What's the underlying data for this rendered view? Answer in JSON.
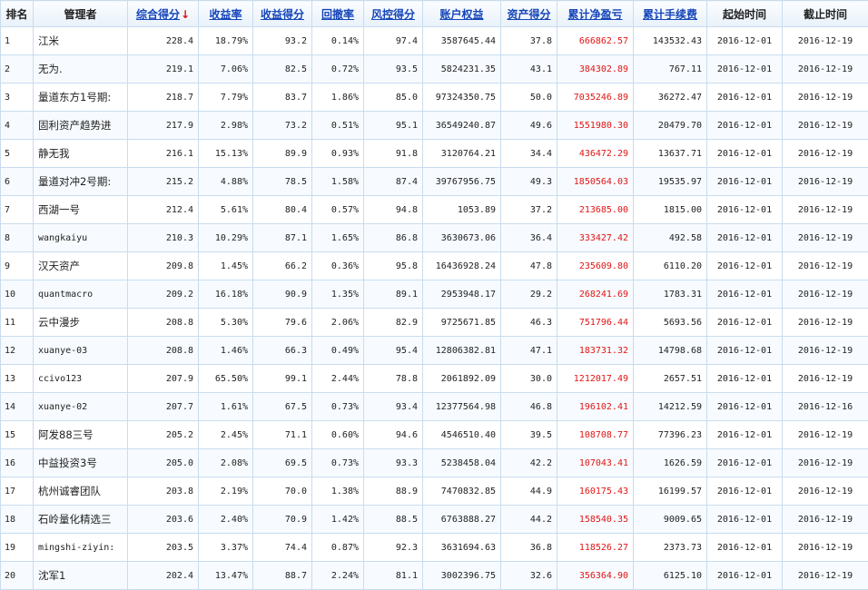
{
  "header": {
    "rank": "排名",
    "manager": "管理者",
    "total_score": "综合得分",
    "sort_arrow": "↓",
    "return_rate": "收益率",
    "return_score": "收益得分",
    "drawdown": "回撤率",
    "risk_score": "风控得分",
    "equity": "账户权益",
    "asset_score": "资产得分",
    "net_pnl": "累计净盈亏",
    "fees": "累计手续费",
    "start_date": "起始时间",
    "end_date": "截止时间"
  },
  "colors": {
    "link": "#1545b8",
    "sort_arrow": "#e01010",
    "pnl": "#e01515",
    "grid": "#c9dced"
  },
  "rows": [
    {
      "rank": "1",
      "manager": "江米",
      "total": "228.4",
      "ret": "18.79%",
      "rets": "93.2",
      "dd": "0.14%",
      "risk": "97.4",
      "equity": "3587645.44",
      "asset": "37.8",
      "pnl": "666862.57",
      "fee": "143532.43",
      "start": "2016-12-01",
      "end": "2016-12-19"
    },
    {
      "rank": "2",
      "manager": "无为.",
      "total": "219.1",
      "ret": "7.06%",
      "rets": "82.5",
      "dd": "0.72%",
      "risk": "93.5",
      "equity": "5824231.35",
      "asset": "43.1",
      "pnl": "384302.89",
      "fee": "767.11",
      "start": "2016-12-01",
      "end": "2016-12-19"
    },
    {
      "rank": "3",
      "manager": "量道东方1号期:",
      "total": "218.7",
      "ret": "7.79%",
      "rets": "83.7",
      "dd": "1.86%",
      "risk": "85.0",
      "equity": "97324350.75",
      "asset": "50.0",
      "pnl": "7035246.89",
      "fee": "36272.47",
      "start": "2016-12-01",
      "end": "2016-12-19"
    },
    {
      "rank": "4",
      "manager": "固利资产趋势进",
      "total": "217.9",
      "ret": "2.98%",
      "rets": "73.2",
      "dd": "0.51%",
      "risk": "95.1",
      "equity": "36549240.87",
      "asset": "49.6",
      "pnl": "1551980.30",
      "fee": "20479.70",
      "start": "2016-12-01",
      "end": "2016-12-19"
    },
    {
      "rank": "5",
      "manager": "静无我",
      "total": "216.1",
      "ret": "15.13%",
      "rets": "89.9",
      "dd": "0.93%",
      "risk": "91.8",
      "equity": "3120764.21",
      "asset": "34.4",
      "pnl": "436472.29",
      "fee": "13637.71",
      "start": "2016-12-01",
      "end": "2016-12-19"
    },
    {
      "rank": "6",
      "manager": "量道对冲2号期:",
      "total": "215.2",
      "ret": "4.88%",
      "rets": "78.5",
      "dd": "1.58%",
      "risk": "87.4",
      "equity": "39767956.75",
      "asset": "49.3",
      "pnl": "1850564.03",
      "fee": "19535.97",
      "start": "2016-12-01",
      "end": "2016-12-19"
    },
    {
      "rank": "7",
      "manager": "西湖一号",
      "total": "212.4",
      "ret": "5.61%",
      "rets": "80.4",
      "dd": "0.57%",
      "risk": "94.8",
      "equity": "1053.89",
      "asset": "37.2",
      "pnl": "213685.00",
      "fee": "1815.00",
      "start": "2016-12-01",
      "end": "2016-12-19"
    },
    {
      "rank": "8",
      "manager": "wangkaiyu",
      "total": "210.3",
      "ret": "10.29%",
      "rets": "87.1",
      "dd": "1.65%",
      "risk": "86.8",
      "equity": "3630673.06",
      "asset": "36.4",
      "pnl": "333427.42",
      "fee": "492.58",
      "start": "2016-12-01",
      "end": "2016-12-19"
    },
    {
      "rank": "9",
      "manager": "汉天资产",
      "total": "209.8",
      "ret": "1.45%",
      "rets": "66.2",
      "dd": "0.36%",
      "risk": "95.8",
      "equity": "16436928.24",
      "asset": "47.8",
      "pnl": "235609.80",
      "fee": "6110.20",
      "start": "2016-12-01",
      "end": "2016-12-19"
    },
    {
      "rank": "10",
      "manager": "quantmacro",
      "total": "209.2",
      "ret": "16.18%",
      "rets": "90.9",
      "dd": "1.35%",
      "risk": "89.1",
      "equity": "2953948.17",
      "asset": "29.2",
      "pnl": "268241.69",
      "fee": "1783.31",
      "start": "2016-12-01",
      "end": "2016-12-19"
    },
    {
      "rank": "11",
      "manager": "云中漫步",
      "total": "208.8",
      "ret": "5.30%",
      "rets": "79.6",
      "dd": "2.06%",
      "risk": "82.9",
      "equity": "9725671.85",
      "asset": "46.3",
      "pnl": "751796.44",
      "fee": "5693.56",
      "start": "2016-12-01",
      "end": "2016-12-19"
    },
    {
      "rank": "12",
      "manager": "xuanye-03",
      "total": "208.8",
      "ret": "1.46%",
      "rets": "66.3",
      "dd": "0.49%",
      "risk": "95.4",
      "equity": "12806382.81",
      "asset": "47.1",
      "pnl": "183731.32",
      "fee": "14798.68",
      "start": "2016-12-01",
      "end": "2016-12-19"
    },
    {
      "rank": "13",
      "manager": "ccivo123",
      "total": "207.9",
      "ret": "65.50%",
      "rets": "99.1",
      "dd": "2.44%",
      "risk": "78.8",
      "equity": "2061892.09",
      "asset": "30.0",
      "pnl": "1212017.49",
      "fee": "2657.51",
      "start": "2016-12-01",
      "end": "2016-12-19"
    },
    {
      "rank": "14",
      "manager": "xuanye-02",
      "total": "207.7",
      "ret": "1.61%",
      "rets": "67.5",
      "dd": "0.73%",
      "risk": "93.4",
      "equity": "12377564.98",
      "asset": "46.8",
      "pnl": "196102.41",
      "fee": "14212.59",
      "start": "2016-12-01",
      "end": "2016-12-16"
    },
    {
      "rank": "15",
      "manager": "阿发88三号",
      "total": "205.2",
      "ret": "2.45%",
      "rets": "71.1",
      "dd": "0.60%",
      "risk": "94.6",
      "equity": "4546510.40",
      "asset": "39.5",
      "pnl": "108708.77",
      "fee": "77396.23",
      "start": "2016-12-01",
      "end": "2016-12-19"
    },
    {
      "rank": "16",
      "manager": "中益投资3号",
      "total": "205.0",
      "ret": "2.08%",
      "rets": "69.5",
      "dd": "0.73%",
      "risk": "93.3",
      "equity": "5238458.04",
      "asset": "42.2",
      "pnl": "107043.41",
      "fee": "1626.59",
      "start": "2016-12-01",
      "end": "2016-12-19"
    },
    {
      "rank": "17",
      "manager": "杭州诚睿团队",
      "total": "203.8",
      "ret": "2.19%",
      "rets": "70.0",
      "dd": "1.38%",
      "risk": "88.9",
      "equity": "7470832.85",
      "asset": "44.9",
      "pnl": "160175.43",
      "fee": "16199.57",
      "start": "2016-12-01",
      "end": "2016-12-19"
    },
    {
      "rank": "18",
      "manager": "石岭量化精选三",
      "total": "203.6",
      "ret": "2.40%",
      "rets": "70.9",
      "dd": "1.42%",
      "risk": "88.5",
      "equity": "6763888.27",
      "asset": "44.2",
      "pnl": "158540.35",
      "fee": "9009.65",
      "start": "2016-12-01",
      "end": "2016-12-19"
    },
    {
      "rank": "19",
      "manager": "mingshi-ziyin:",
      "total": "203.5",
      "ret": "3.37%",
      "rets": "74.4",
      "dd": "0.87%",
      "risk": "92.3",
      "equity": "3631694.63",
      "asset": "36.8",
      "pnl": "118526.27",
      "fee": "2373.73",
      "start": "2016-12-01",
      "end": "2016-12-19"
    },
    {
      "rank": "20",
      "manager": "沈军1",
      "total": "202.4",
      "ret": "13.47%",
      "rets": "88.7",
      "dd": "2.24%",
      "risk": "81.1",
      "equity": "3002396.75",
      "asset": "32.6",
      "pnl": "356364.90",
      "fee": "6125.10",
      "start": "2016-12-01",
      "end": "2016-12-19"
    }
  ]
}
